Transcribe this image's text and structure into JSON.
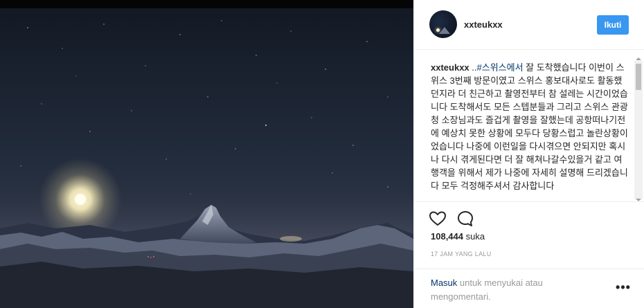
{
  "post": {
    "username": "xxteukxx",
    "follow_label": "Ikuti",
    "caption": {
      "username": "xxteukxx",
      "pre_tag": " ..",
      "hashtag": "#스위스에서",
      "text": " 잘 도착했습니다 이번이 스위스 3번째 방문이였고 스위스 홍보대사로도 활동했던지라 더 친근하고 촬영전부터 참 설레는 시간이었습니다 도착해서도 모든 스텝분들과 그리고 스위스 관광청 소장님과도 즐겁게 촬영을 잘했는데 공항떠나기전에 예상치 못한 상황에 모두다 당황스럽고 놀란상황이었습니다 나중에 이런일을 다시겪으면 안되지만 혹시나 다시 겪게된다면 더 잘 해쳐나갈수있을거 같고 여행객을 위해서 제가 나중에 자세히 설명해 드리겠습니다 모두 걱정해주셔서 감사합니다"
    },
    "likes_count": "108,444",
    "likes_suffix": " suka",
    "time_ago": "17 JAM YANG LALU",
    "footer": {
      "login_link": "Masuk",
      "login_rest": " untuk menyukai atau mengomentari."
    },
    "more_label": "•••"
  },
  "icons": {
    "like": "heart-icon",
    "comment": "comment-icon",
    "more": "more-icon"
  },
  "colors": {
    "follow_button": "#3897f0",
    "link": "#003569",
    "muted": "#999999"
  }
}
